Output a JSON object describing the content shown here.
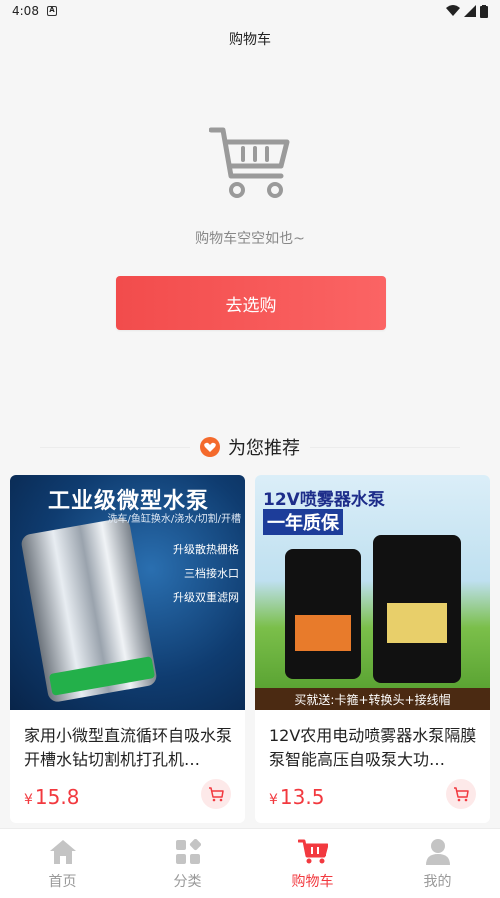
{
  "status_bar": {
    "time": "4:08",
    "notif_glyph": "A"
  },
  "header": {
    "title": "购物车"
  },
  "empty_state": {
    "icon": "cart-icon",
    "message": "购物车空空如也~",
    "button_label": "去选购"
  },
  "recommend": {
    "title": "为您推荐",
    "products": [
      {
        "name": "家用小微型直流循环自吸水泵开槽水钻切割机打孔机…",
        "price": "15.8",
        "currency": "¥",
        "image_text": {
          "headline": "工业级微型水泵",
          "sub": "洗车/鱼缸换水/浇水/切割/开槽",
          "features": [
            "升级散热栅格",
            "三档接水口",
            "升级双重滤网"
          ]
        }
      },
      {
        "name": "12V农用电动喷雾器水泵隔膜泵智能高压自吸泵大功…",
        "price": "13.5",
        "currency": "¥",
        "image_text": {
          "headline": "12V喷雾器水泵",
          "headline2": "一年质保",
          "bottom": "买就送:卡箍+转换头+接线帽"
        }
      }
    ]
  },
  "tabbar": {
    "tabs": [
      {
        "label": "首页",
        "icon": "home-icon",
        "active": false
      },
      {
        "label": "分类",
        "icon": "category-icon",
        "active": false
      },
      {
        "label": "购物车",
        "icon": "cart-icon",
        "active": true
      },
      {
        "label": "我的",
        "icon": "profile-icon",
        "active": false
      }
    ]
  },
  "colors": {
    "accent": "#f2393f",
    "button_gradient_start": "#f24c4c",
    "button_gradient_end": "#fb6464",
    "heart": "#f46a2c"
  }
}
